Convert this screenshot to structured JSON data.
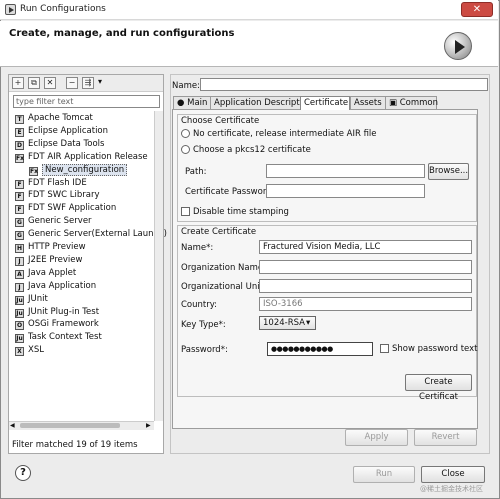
{
  "window": {
    "title": "Run Configurations",
    "close_glyph": "✕"
  },
  "banner": {
    "title": "Create, manage, and run configurations"
  },
  "left": {
    "toolbar": [
      "new-icon",
      "duplicate-icon",
      "delete-icon",
      "collapse-icon",
      "filter-icon",
      "dropdown-icon"
    ],
    "filter_placeholder": "type filter text",
    "tree": [
      {
        "label": "Apache Tomcat",
        "icon": "T",
        "indent": 1
      },
      {
        "label": "Eclipse Application",
        "icon": "E",
        "indent": 1
      },
      {
        "label": "Eclipse Data Tools",
        "icon": "D",
        "indent": 1
      },
      {
        "label": "FDT AIR Application Release",
        "icon": "Fx",
        "indent": 1
      },
      {
        "label": "New_configuration",
        "icon": "Fx",
        "indent": 2,
        "selected": true
      },
      {
        "label": "FDT Flash IDE",
        "icon": "F",
        "indent": 1
      },
      {
        "label": "FDT SWC Library",
        "icon": "F",
        "indent": 1
      },
      {
        "label": "FDT SWF Application",
        "icon": "F",
        "indent": 1
      },
      {
        "label": "Generic Server",
        "icon": "G",
        "indent": 1
      },
      {
        "label": "Generic Server(External Launch)",
        "icon": "G",
        "indent": 1
      },
      {
        "label": "HTTP Preview",
        "icon": "H",
        "indent": 1
      },
      {
        "label": "J2EE Preview",
        "icon": "J",
        "indent": 1
      },
      {
        "label": "Java Applet",
        "icon": "A",
        "indent": 1
      },
      {
        "label": "Java Application",
        "icon": "J",
        "indent": 1
      },
      {
        "label": "JUnit",
        "icon": "Ju",
        "indent": 1
      },
      {
        "label": "JUnit Plug-in Test",
        "icon": "Ju",
        "indent": 1
      },
      {
        "label": "OSGi Framework",
        "icon": "O",
        "indent": 1
      },
      {
        "label": "Task Context Test",
        "icon": "Ju",
        "indent": 1
      },
      {
        "label": "XSL",
        "icon": "X",
        "indent": 1
      }
    ],
    "status": "Filter matched 19 of 19 items"
  },
  "right": {
    "name_label": "Name:",
    "name_value": "",
    "tabs": [
      "Main",
      "Application Descriptor",
      "Certificate",
      "Assets",
      "Common"
    ],
    "active_tab": "Certificate",
    "choose": {
      "title": "Choose Certificate",
      "opt_none": "No certificate, release intermediate AIR file",
      "opt_p12": "Choose a pkcs12 certificate",
      "path_label": "Path:",
      "browse": "Browse...",
      "cert_pw_label": "Certificate Password:",
      "disable_ts": "Disable time stamping"
    },
    "create": {
      "title": "Create Certificate",
      "name_label": "Name*:",
      "name_value": "Fractured Vision Media, LLC",
      "org_label": "Organization Name:",
      "org_value": "",
      "unit_label": "Organizational Unit:",
      "unit_value": "",
      "country_label": "Country:",
      "country_placeholder": "ISO-3166",
      "keytype_label": "Key Type*:",
      "keytype_value": "1024-RSA",
      "password_label": "Password*:",
      "password_value": "●●●●●●●●●●●",
      "show_pw": "Show password text",
      "create_btn": "Create Certificat"
    },
    "apply": "Apply",
    "revert": "Revert"
  },
  "footer": {
    "help": "?",
    "run": "Run",
    "close": "Close"
  },
  "watermark": "@稀土掘金技术社区"
}
